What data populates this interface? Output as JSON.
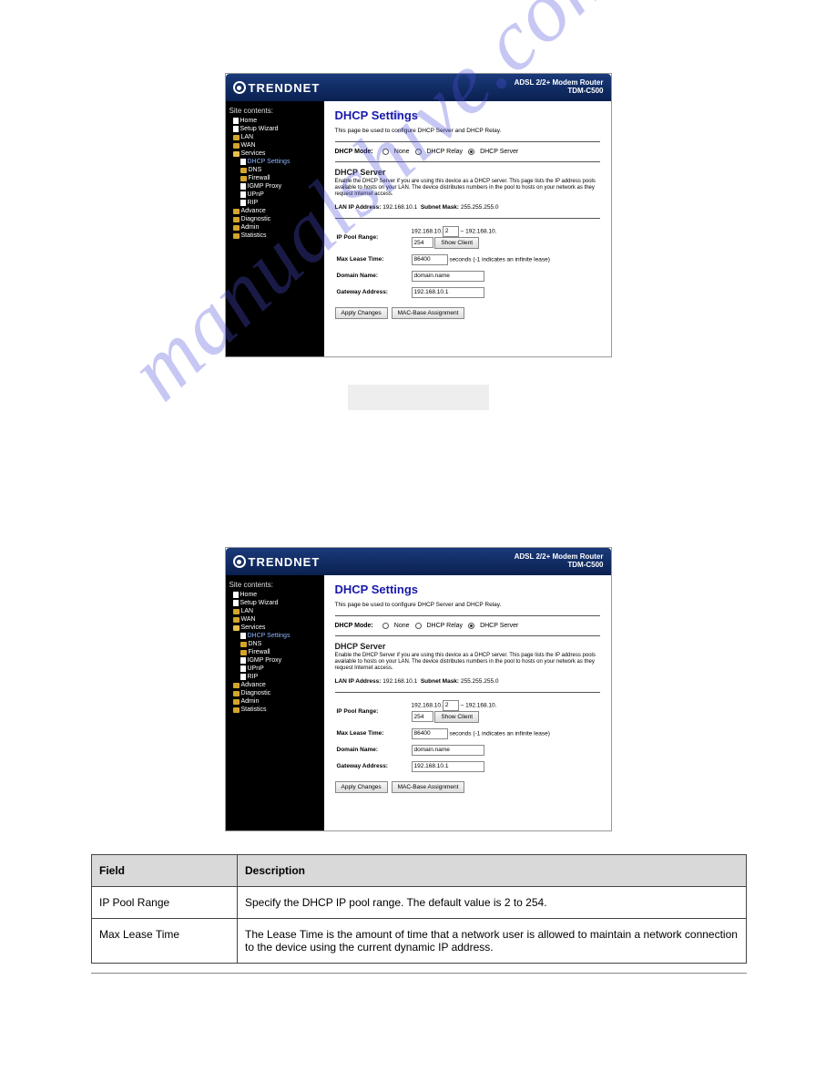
{
  "watermark": "manualshive.com",
  "header": {
    "brand": "TRENDNET",
    "device_line1": "ADSL 2/2+ Modem Router",
    "device_line2": "TDM-C500"
  },
  "sidebar": {
    "title": "Site contents:",
    "items": [
      {
        "label": "Home",
        "level": 1,
        "icon": "page"
      },
      {
        "label": "Setup Wizard",
        "level": 1,
        "icon": "page"
      },
      {
        "label": "LAN",
        "level": 1,
        "icon": "folder"
      },
      {
        "label": "WAN",
        "level": 1,
        "icon": "folder"
      },
      {
        "label": "Services",
        "level": 1,
        "icon": "folder-open"
      },
      {
        "label": "DHCP Settings",
        "level": 2,
        "icon": "page",
        "hl": true
      },
      {
        "label": "DNS",
        "level": 2,
        "icon": "folder"
      },
      {
        "label": "Firewall",
        "level": 2,
        "icon": "folder"
      },
      {
        "label": "IGMP Proxy",
        "level": 2,
        "icon": "page"
      },
      {
        "label": "UPnP",
        "level": 2,
        "icon": "page"
      },
      {
        "label": "RIP",
        "level": 2,
        "icon": "page"
      },
      {
        "label": "Advance",
        "level": 1,
        "icon": "folder"
      },
      {
        "label": "Diagnostic",
        "level": 1,
        "icon": "folder"
      },
      {
        "label": "Admin",
        "level": 1,
        "icon": "folder"
      },
      {
        "label": "Statistics",
        "level": 1,
        "icon": "folder"
      }
    ]
  },
  "main": {
    "title": "DHCP Settings",
    "desc": "This page be used to configure DHCP Server and DHCP Relay.",
    "mode_label": "DHCP Mode:",
    "mode_options": [
      "None",
      "DHCP Relay",
      "DHCP Server"
    ],
    "mode_selected": 2,
    "server_title": "DHCP Server",
    "server_desc": "Enable the DHCP Server if you are using this device as a DHCP server. This page lists the IP address pools available to hosts on your LAN. The device distributes numbers in the pool to hosts on your network as they request Internet access.",
    "lan_ip_label": "LAN IP Address:",
    "lan_ip": "192.168.10.1",
    "subnet_label": "Subnet Mask:",
    "subnet": "255.255.255.0",
    "fields": {
      "ip_pool_label": "IP Pool Range:",
      "ip_pool_prefix": "192.168.10.",
      "ip_pool_start": "2",
      "ip_pool_dash": "–",
      "ip_pool_prefix2": "192.168.10.",
      "ip_pool_end": "254",
      "show_client": "Show Client",
      "max_lease_label": "Max Lease Time:",
      "max_lease": "86400",
      "max_lease_suffix": "seconds (-1 indicates an infinite lease)",
      "domain_label": "Domain Name:",
      "domain": "domain.name",
      "gateway_label": "Gateway Address:",
      "gateway": "192.168.10.1"
    },
    "apply_btn": "Apply Changes",
    "mac_btn": "MAC-Base Assignment"
  },
  "field_table": {
    "col1": "Field",
    "col2": "Description",
    "rows": [
      {
        "label": "IP Pool Range",
        "desc": "Specify the DHCP IP pool range. The default value is 2 to 254."
      },
      {
        "label": "Max Lease Time",
        "desc": "The Lease Time is the amount of time that a network user is allowed to maintain a network connection to the device using the current dynamic IP address."
      }
    ]
  }
}
